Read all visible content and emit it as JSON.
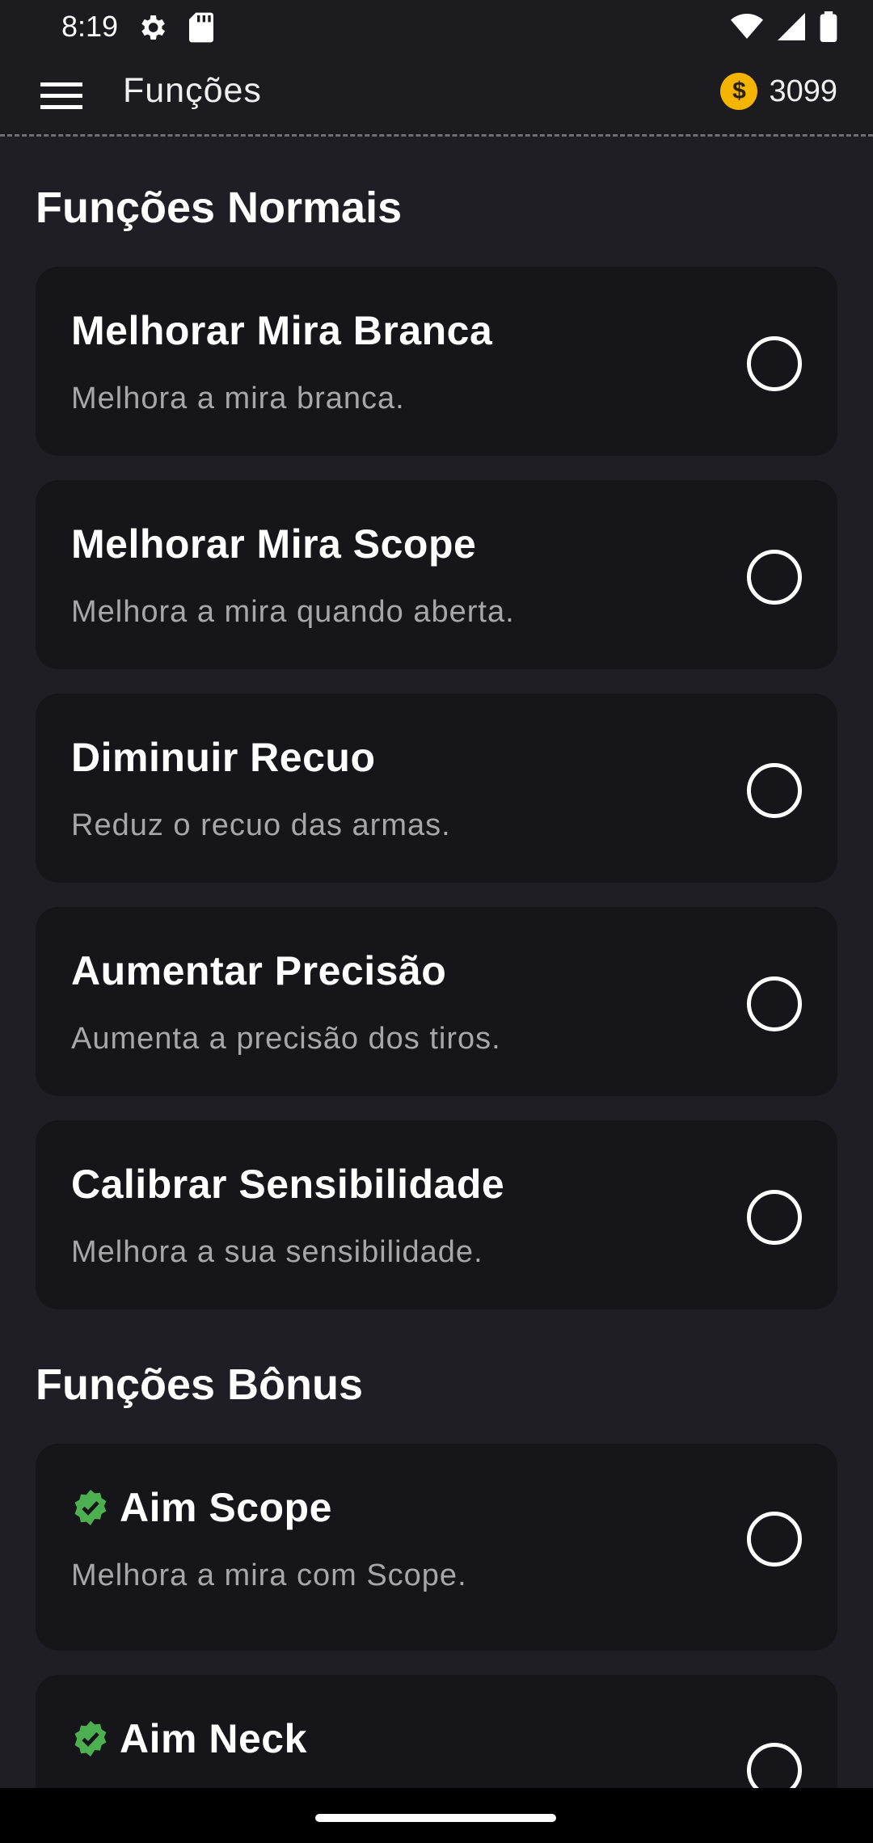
{
  "status_bar": {
    "time": "8:19",
    "icons": [
      "gear-icon",
      "sd-card-icon",
      "wifi-icon",
      "signal-icon",
      "battery-icon"
    ]
  },
  "toolbar": {
    "title": "Funções",
    "menu_icon": "hamburger-menu-icon",
    "coin_symbol": "$",
    "coin_value": "3099"
  },
  "sections": {
    "normal": {
      "title": "Funções Normais",
      "items": [
        {
          "title": "Melhorar Mira Branca",
          "desc": "Melhora a mira branca.",
          "checked": false
        },
        {
          "title": "Melhorar Mira Scope",
          "desc": "Melhora a mira quando aberta.",
          "checked": false
        },
        {
          "title": "Diminuir Recuo",
          "desc": "Reduz o recuo das armas.",
          "checked": false
        },
        {
          "title": "Aumentar Precisão",
          "desc": "Aumenta a precisão dos tiros.",
          "checked": false
        },
        {
          "title": "Calibrar Sensibilidade",
          "desc": "Melhora a sua sensibilidade.",
          "checked": false
        }
      ]
    },
    "bonus": {
      "title": "Funções Bônus",
      "items": [
        {
          "title": "Aim Scope",
          "desc": "Melhora a mira com Scope.",
          "checked": false,
          "badge": "verified-icon"
        },
        {
          "title": "Aim Neck",
          "desc": "",
          "checked": false,
          "badge": "verified-icon"
        }
      ]
    }
  },
  "colors": {
    "background": "#1e1e24",
    "card": "#16161a",
    "coin": "#f5b400",
    "verified": "#4caf50"
  }
}
